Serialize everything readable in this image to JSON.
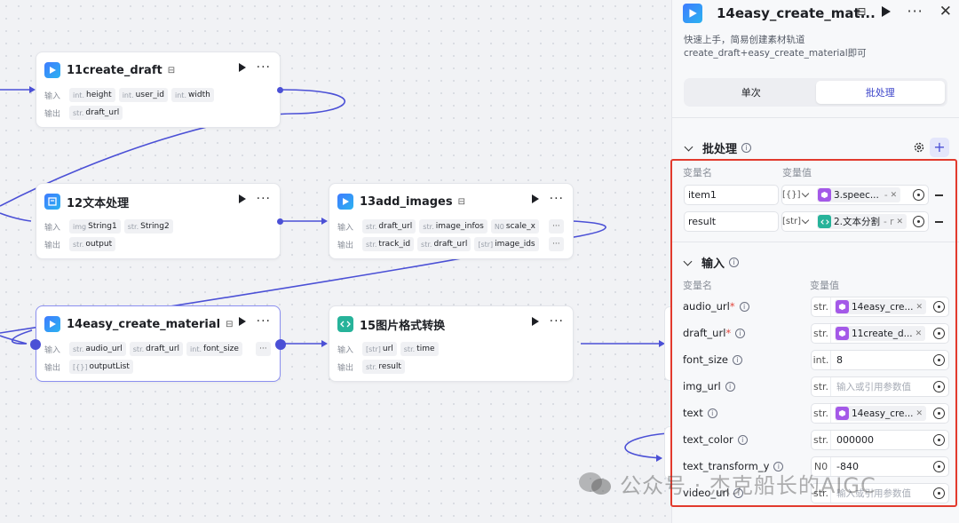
{
  "canvas": {
    "nodes": [
      {
        "id": "n11",
        "title": "11create_draft",
        "icon": "capcut-icon",
        "input_label": "输入",
        "output_label": "输出",
        "inputs": [
          {
            "type": "int.",
            "name": "height"
          },
          {
            "type": "int.",
            "name": "user_id"
          },
          {
            "type": "int.",
            "name": "width"
          }
        ],
        "outputs": [
          {
            "type": "str.",
            "name": "draft_url"
          }
        ]
      },
      {
        "id": "n12",
        "title": "12文本处理",
        "icon": "text-process-icon",
        "input_label": "输入",
        "output_label": "输出",
        "inputs": [
          {
            "type": "img",
            "name": "String1"
          },
          {
            "type": "str.",
            "name": "String2"
          }
        ],
        "outputs": [
          {
            "type": "str.",
            "name": "output"
          }
        ]
      },
      {
        "id": "n13",
        "title": "13add_images",
        "icon": "capcut-icon",
        "input_label": "输入",
        "output_label": "输出",
        "inputs": [
          {
            "type": "str.",
            "name": "draft_url"
          },
          {
            "type": "str.",
            "name": "image_infos"
          },
          {
            "type": "N0",
            "name": "scale_x"
          }
        ],
        "outputs": [
          {
            "type": "str.",
            "name": "track_id"
          },
          {
            "type": "str.",
            "name": "draft_url"
          },
          {
            "type": "[str]",
            "name": "image_ids"
          }
        ]
      },
      {
        "id": "n14",
        "title": "14easy_create_material",
        "icon": "capcut-icon",
        "input_label": "输入",
        "output_label": "输出",
        "inputs": [
          {
            "type": "str.",
            "name": "audio_url"
          },
          {
            "type": "str.",
            "name": "draft_url"
          },
          {
            "type": "int.",
            "name": "font_size"
          }
        ],
        "outputs": [
          {
            "type": "[{}]",
            "name": "outputList"
          }
        ]
      },
      {
        "id": "n15",
        "title": "15图片格式转换",
        "icon": "code-icon",
        "input_label": "输入",
        "output_label": "输出",
        "inputs": [
          {
            "type": "[str]",
            "name": "url"
          },
          {
            "type": "str.",
            "name": "time"
          }
        ],
        "outputs": [
          {
            "type": "str.",
            "name": "result"
          }
        ]
      }
    ]
  },
  "panel": {
    "title": "14easy_create_mat...",
    "description": "快速上手，简易创建素材轨道 create_draft+easy_create_material即可",
    "tabs": [
      {
        "label": "单次",
        "active": false
      },
      {
        "label": "批处理",
        "active": true
      }
    ],
    "batch": {
      "title": "批处理",
      "col_name": "变量名",
      "col_value": "变量值",
      "rows": [
        {
          "name": "item1",
          "type": "[{}]",
          "ref_label": "3.speec...",
          "ref_suffix": "- ",
          "ref_color": "#a459e8"
        },
        {
          "name": "result",
          "type": "[str]",
          "ref_label": "2.文本分割",
          "ref_suffix": "- r",
          "ref_color": "#27b39a"
        }
      ]
    },
    "inputs": {
      "title": "输入",
      "col_name": "变量名",
      "col_value": "变量值",
      "rows": [
        {
          "name": "audio_url",
          "required": true,
          "type": "str.",
          "kind": "ref",
          "value": "14easy_cre..."
        },
        {
          "name": "draft_url",
          "required": true,
          "type": "str.",
          "kind": "ref",
          "value": "11create_d..."
        },
        {
          "name": "font_size",
          "required": false,
          "type": "int.",
          "kind": "value",
          "value": "8"
        },
        {
          "name": "img_url",
          "required": false,
          "type": "str.",
          "kind": "placeholder",
          "value": "输入或引用参数值"
        },
        {
          "name": "text",
          "required": false,
          "type": "str.",
          "kind": "ref",
          "value": "14easy_cre..."
        },
        {
          "name": "text_color",
          "required": false,
          "type": "str.",
          "kind": "value",
          "value": "000000"
        },
        {
          "name": "text_transform_y",
          "required": false,
          "type": "N0",
          "kind": "value",
          "value": "-840"
        },
        {
          "name": "video_url",
          "required": false,
          "type": "str.",
          "kind": "placeholder",
          "value": "输入或引用参数值"
        }
      ]
    }
  },
  "watermark": "公众号 · 杰克船长的AIGC",
  "colors": {
    "accent": "#4b50d6",
    "highlight_box": "#e23a2d",
    "plugin_purple": "#a459e8",
    "code_teal": "#27b39a"
  }
}
